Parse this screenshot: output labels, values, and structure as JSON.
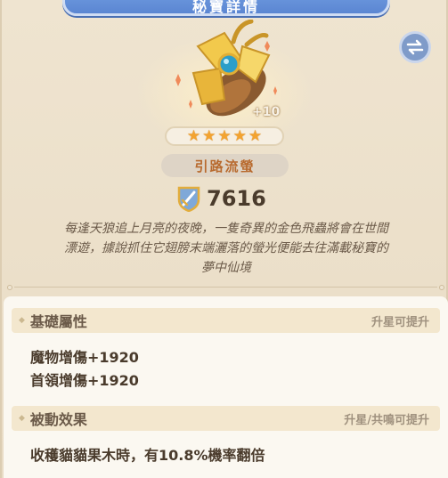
{
  "header": {
    "title": "秘寶詳情"
  },
  "item": {
    "enhance": "+10",
    "stars": 5,
    "name": "引路流螢",
    "power": "7616",
    "description_lines": [
      "每逢天狼追上月亮的夜晚，一隻奇異的金色飛蟲將會在世間",
      "漂遊，據說抓住它翅膀末端灑落的螢光便能去往滿載秘寶的",
      "夢中仙境"
    ]
  },
  "sections": [
    {
      "title": "基礎屬性",
      "hint": "升星可提升",
      "lines": [
        "魔物增傷+1920",
        "首領增傷+1920"
      ]
    },
    {
      "title": "被動效果",
      "hint": "升星/共鳴可提升",
      "lines": [
        "收穫貓貓果木時，有10.8%機率翻倍"
      ]
    }
  ],
  "icons": {
    "swap": "swap-arrows-icon",
    "power": "shield-sword-icon",
    "star": "star-icon"
  },
  "colors": {
    "title_bar": "#6f9be0",
    "star": "#f3a330",
    "name": "#b86a2e"
  }
}
